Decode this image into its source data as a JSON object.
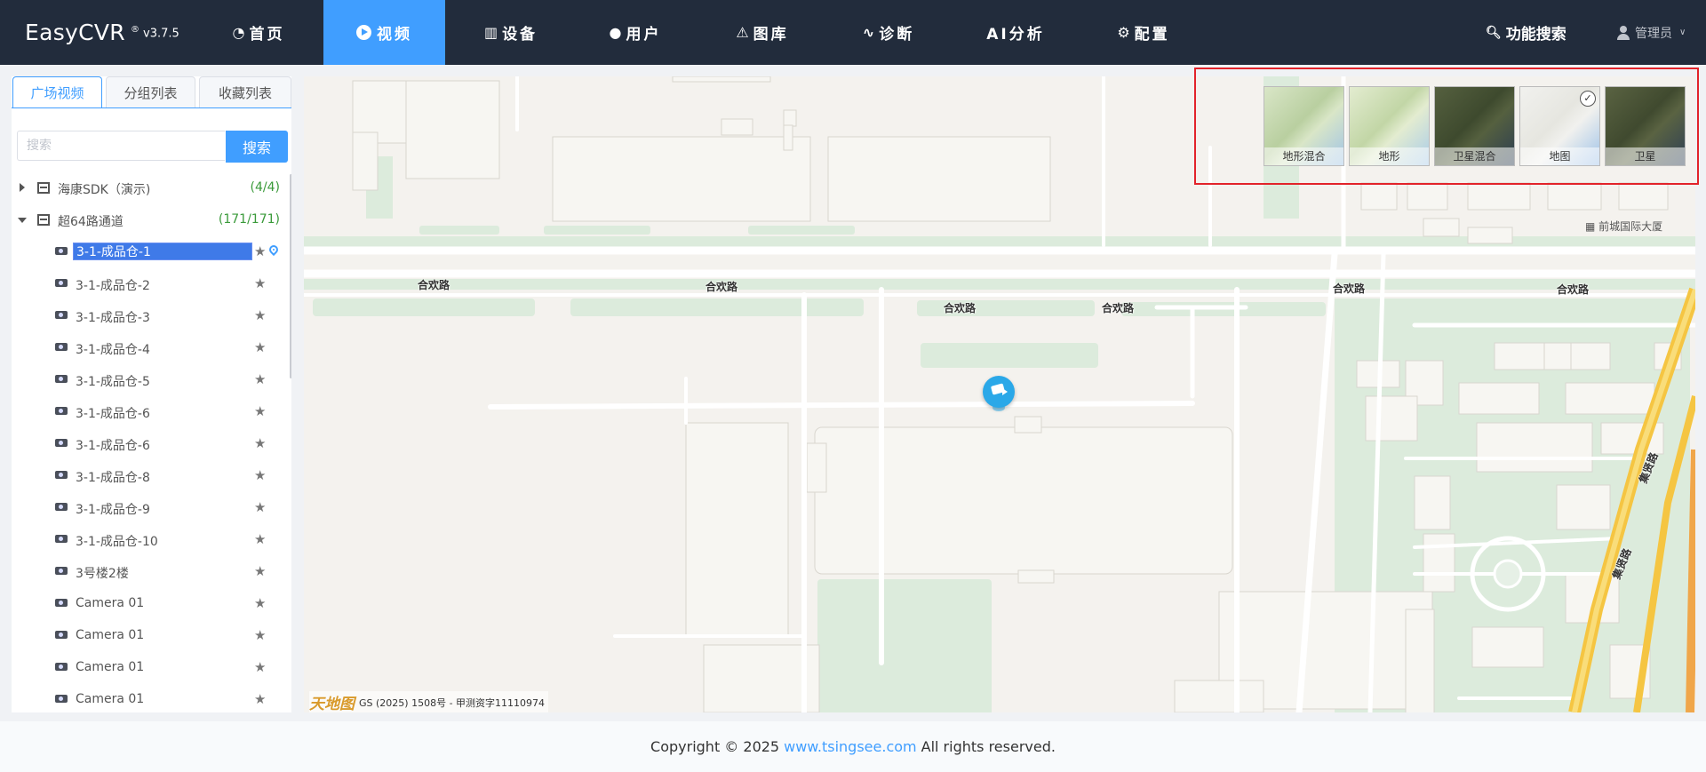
{
  "app": {
    "name": "EasyCVR",
    "version_mark": "®",
    "version": "v3.7.5"
  },
  "nav": {
    "items": [
      {
        "label": "首页",
        "icon": "dashboard-icon"
      },
      {
        "label": "视频",
        "icon": "play-icon",
        "active": true
      },
      {
        "label": "设备",
        "icon": "device-icon"
      },
      {
        "label": "用户",
        "icon": "user-icon"
      },
      {
        "label": "图库",
        "icon": "alarm-icon"
      },
      {
        "label": "诊断",
        "icon": "pulse-icon"
      },
      {
        "label": "AI分析",
        "icon": ""
      },
      {
        "label": "配置",
        "icon": "gear-icon"
      }
    ],
    "function_search": "功能搜索",
    "user": "管理员"
  },
  "sidebar": {
    "tabs": [
      "广场视频",
      "分组列表",
      "收藏列表"
    ],
    "active_tab": "广场视频",
    "search": {
      "placeholder": "搜索",
      "button": "搜索"
    },
    "groups": [
      {
        "label": "海康SDK（演示)",
        "count": "(4/4)",
        "expanded": false
      },
      {
        "label": "超64路通道",
        "count": "(171/171)",
        "expanded": true
      }
    ],
    "channels": [
      {
        "label": "3-1-成品仓-1",
        "selected": true
      },
      {
        "label": "3-1-成品仓-2"
      },
      {
        "label": "3-1-成品仓-3"
      },
      {
        "label": "3-1-成品仓-4"
      },
      {
        "label": "3-1-成品仓-5"
      },
      {
        "label": "3-1-成品仓-6"
      },
      {
        "label": "3-1-成品仓-6"
      },
      {
        "label": "3-1-成品仓-8"
      },
      {
        "label": "3-1-成品仓-9"
      },
      {
        "label": "3-1-成品仓-10"
      },
      {
        "label": "3号楼2楼"
      },
      {
        "label": "Camera 01"
      },
      {
        "label": "Camera 01"
      },
      {
        "label": "Camera 01"
      },
      {
        "label": "Camera 01"
      }
    ]
  },
  "map": {
    "road_labels": [
      "合欢路",
      "合欢路",
      "合欢路",
      "合欢路",
      "合欢路",
      "合欢路",
      "集贤路",
      "集贤路"
    ],
    "poi_label": "前城国际大厦",
    "copyright": "GS (2025) 1508号 - 甲测资字11110974",
    "provider_logo": "天地图",
    "layers": [
      {
        "label": "地形混合",
        "colors": [
          "#d9e6c7",
          "#b9cfa0",
          "#9fc3e6"
        ]
      },
      {
        "label": "地形",
        "colors": [
          "#e3ecd0",
          "#c2d6a6",
          "#a8cbe9"
        ]
      },
      {
        "label": "卫星混合",
        "colors": [
          "#55603f",
          "#3e4a2e",
          "#2c3d52"
        ]
      },
      {
        "label": "地图",
        "colors": [
          "#f1f1ee",
          "#e6e6e0",
          "#9dc1e8"
        ],
        "selected": true
      },
      {
        "label": "卫星",
        "colors": [
          "#5a6342",
          "#404a2f",
          "#2e3f55"
        ]
      }
    ],
    "selected_mark": "✓"
  },
  "footer": {
    "prefix": "Copyright © 2025",
    "link": "www.tsingsee.com",
    "suffix": "All rights reserved."
  }
}
